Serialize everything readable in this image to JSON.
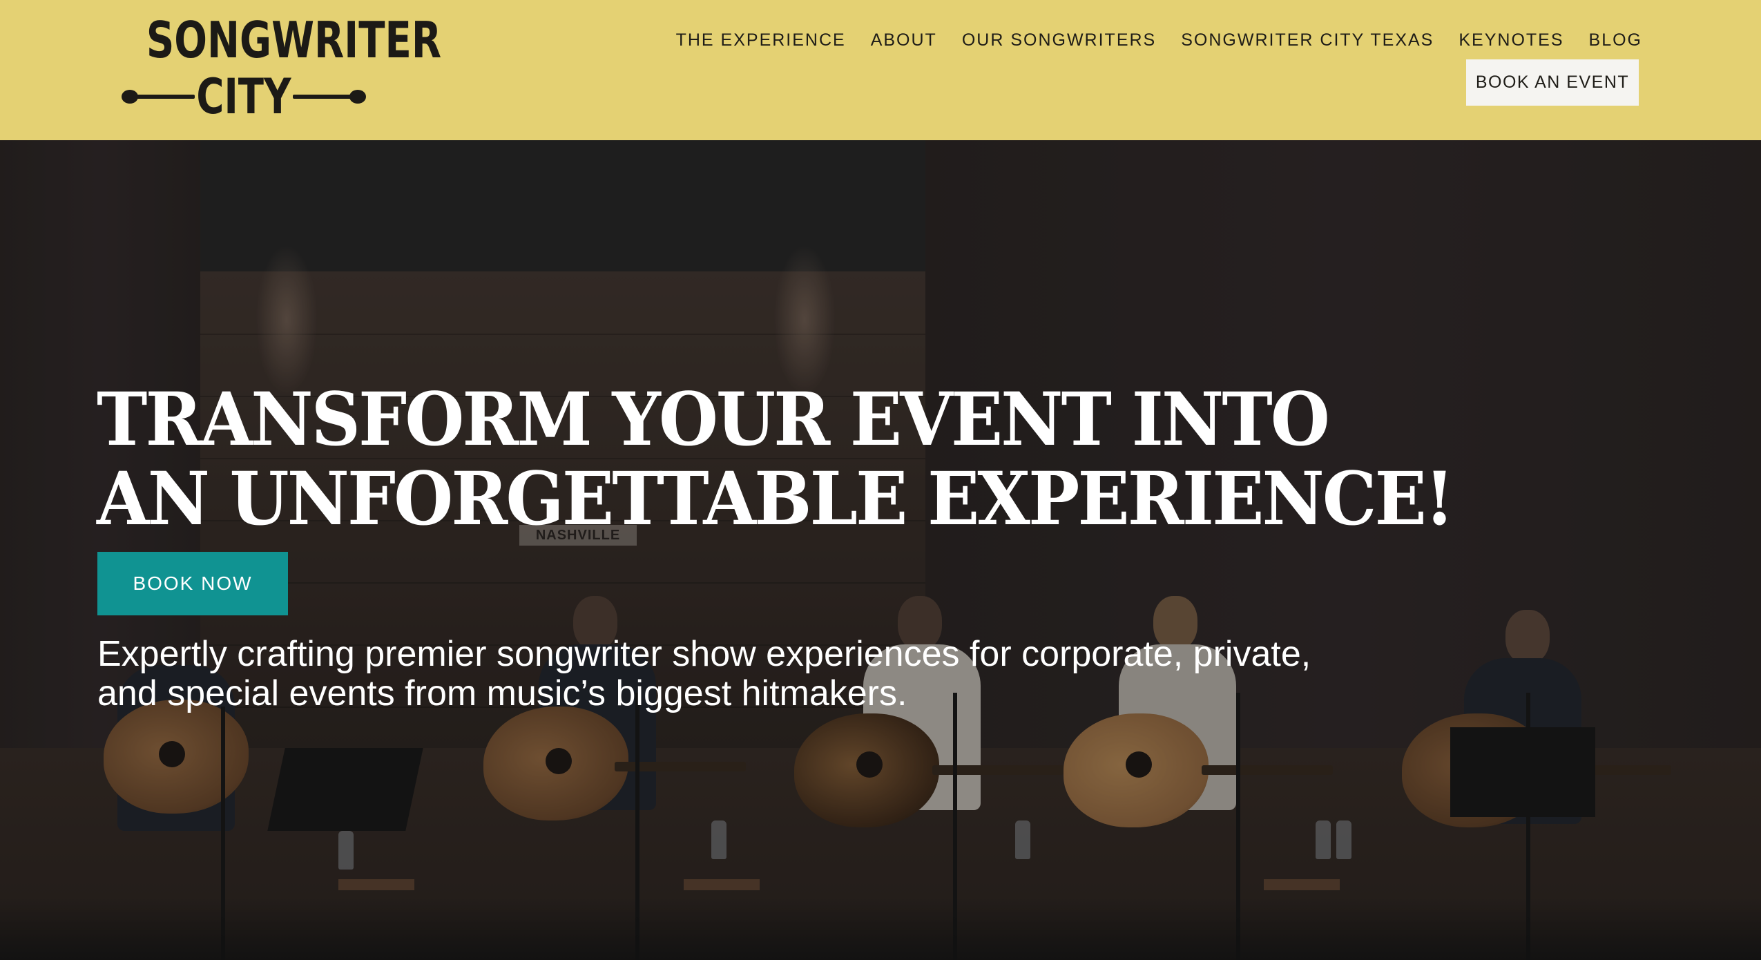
{
  "header": {
    "logo": {
      "line1": "SONGWRITER",
      "line2": "CITY"
    },
    "nav": [
      {
        "label": "THE EXPERIENCE"
      },
      {
        "label": "ABOUT"
      },
      {
        "label": "OUR SONGWRITERS"
      },
      {
        "label": "SONGWRITER CITY TEXAS"
      },
      {
        "label": "KEYNOTES"
      },
      {
        "label": "BLOG"
      }
    ],
    "cta_label": "BOOK AN EVENT"
  },
  "hero": {
    "headline_line1": "TRANSFORM YOUR EVENT INTO",
    "headline_line2": "AN UNFORGETTABLE EXPERIENCE!",
    "button_label": "BOOK NOW",
    "subhead": "Expertly crafting premier songwriter show experiences for corporate, private, and special events from music’s biggest hitmakers.",
    "background_sign": "NASHVILLE"
  },
  "colors": {
    "header_bg": "#e4d173",
    "accent_teal": "#109392",
    "hero_bg": "#262626",
    "text_dark": "#1e1c17",
    "text_light": "#ffffff"
  }
}
